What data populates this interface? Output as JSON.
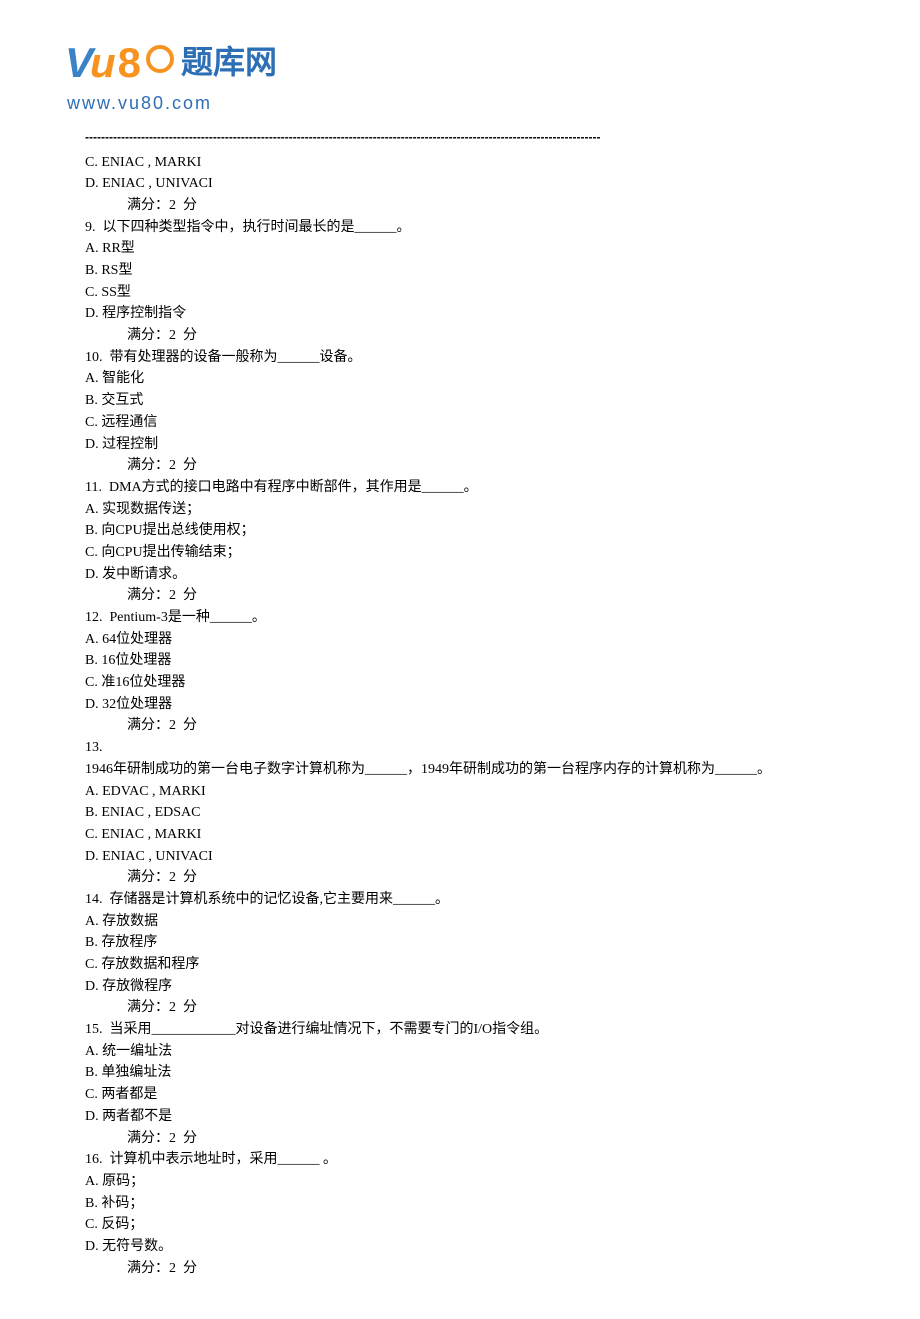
{
  "logo": {
    "text": "题库网",
    "url": "www.vu80.com"
  },
  "divider": "---------------------------------------------------------------------------------------------------------------------------------",
  "items": [
    {
      "type": "opt",
      "text": "C. ENIAC , MARKI"
    },
    {
      "type": "opt",
      "text": "D. ENIAC , UNIVACI"
    },
    {
      "type": "score",
      "text": "满分：2  分"
    },
    {
      "type": "q",
      "text": "9.  以下四种类型指令中，执行时间最长的是______。"
    },
    {
      "type": "opt",
      "text": "A. RR型"
    },
    {
      "type": "opt",
      "text": "B. RS型"
    },
    {
      "type": "opt",
      "text": "C. SS型"
    },
    {
      "type": "opt",
      "text": "D. 程序控制指令"
    },
    {
      "type": "score",
      "text": "满分：2  分"
    },
    {
      "type": "q",
      "text": "10.  带有处理器的设备一般称为______设备。"
    },
    {
      "type": "opt",
      "text": "A. 智能化"
    },
    {
      "type": "opt",
      "text": "B. 交互式"
    },
    {
      "type": "opt",
      "text": "C. 远程通信"
    },
    {
      "type": "opt",
      "text": "D. 过程控制"
    },
    {
      "type": "score",
      "text": "满分：2  分"
    },
    {
      "type": "q",
      "text": "11.  DMA方式的接口电路中有程序中断部件，其作用是______。"
    },
    {
      "type": "opt",
      "text": "A. 实现数据传送；"
    },
    {
      "type": "opt",
      "text": "B. 向CPU提出总线使用权；"
    },
    {
      "type": "opt",
      "text": "C. 向CPU提出传输结束；"
    },
    {
      "type": "opt",
      "text": "D. 发中断请求。"
    },
    {
      "type": "score",
      "text": "满分：2  分"
    },
    {
      "type": "q",
      "text": "12.  Pentium-3是一种______。"
    },
    {
      "type": "opt",
      "text": "A. 64位处理器"
    },
    {
      "type": "opt",
      "text": "B. 16位处理器"
    },
    {
      "type": "opt",
      "text": "C. 准16位处理器"
    },
    {
      "type": "opt",
      "text": "D. 32位处理器"
    },
    {
      "type": "score",
      "text": "满分：2  分"
    },
    {
      "type": "q",
      "text": "13."
    },
    {
      "type": "q13",
      "text": "1946年研制成功的第一台电子数字计算机称为______，1949年研制成功的第一台程序内存的计算机称为______。"
    },
    {
      "type": "opt",
      "text": "A. EDVAC , MARKI"
    },
    {
      "type": "opt",
      "text": "B. ENIAC , EDSAC"
    },
    {
      "type": "opt",
      "text": "C. ENIAC , MARKI"
    },
    {
      "type": "opt",
      "text": "D. ENIAC , UNIVACI"
    },
    {
      "type": "score",
      "text": "满分：2  分"
    },
    {
      "type": "q",
      "text": "14.  存储器是计算机系统中的记忆设备,它主要用来______。"
    },
    {
      "type": "opt",
      "text": "A. 存放数据"
    },
    {
      "type": "opt",
      "text": "B. 存放程序"
    },
    {
      "type": "opt",
      "text": "C. 存放数据和程序"
    },
    {
      "type": "opt",
      "text": "D. 存放微程序"
    },
    {
      "type": "score",
      "text": "满分：2  分"
    },
    {
      "type": "q",
      "text": "15.  当采用____________对设备进行编址情况下，不需要专门的I/O指令组。"
    },
    {
      "type": "opt",
      "text": "A. 统一编址法"
    },
    {
      "type": "opt",
      "text": "B. 单独编址法"
    },
    {
      "type": "opt",
      "text": "C. 两者都是"
    },
    {
      "type": "opt",
      "text": "D. 两者都不是"
    },
    {
      "type": "score",
      "text": "满分：2  分"
    },
    {
      "type": "q",
      "text": "16.  计算机中表示地址时，采用______ 。"
    },
    {
      "type": "opt",
      "text": "A. 原码；"
    },
    {
      "type": "opt",
      "text": "B. 补码；"
    },
    {
      "type": "opt",
      "text": "C. 反码；"
    },
    {
      "type": "opt",
      "text": "D. 无符号数。"
    },
    {
      "type": "score",
      "text": "满分：2  分"
    }
  ]
}
